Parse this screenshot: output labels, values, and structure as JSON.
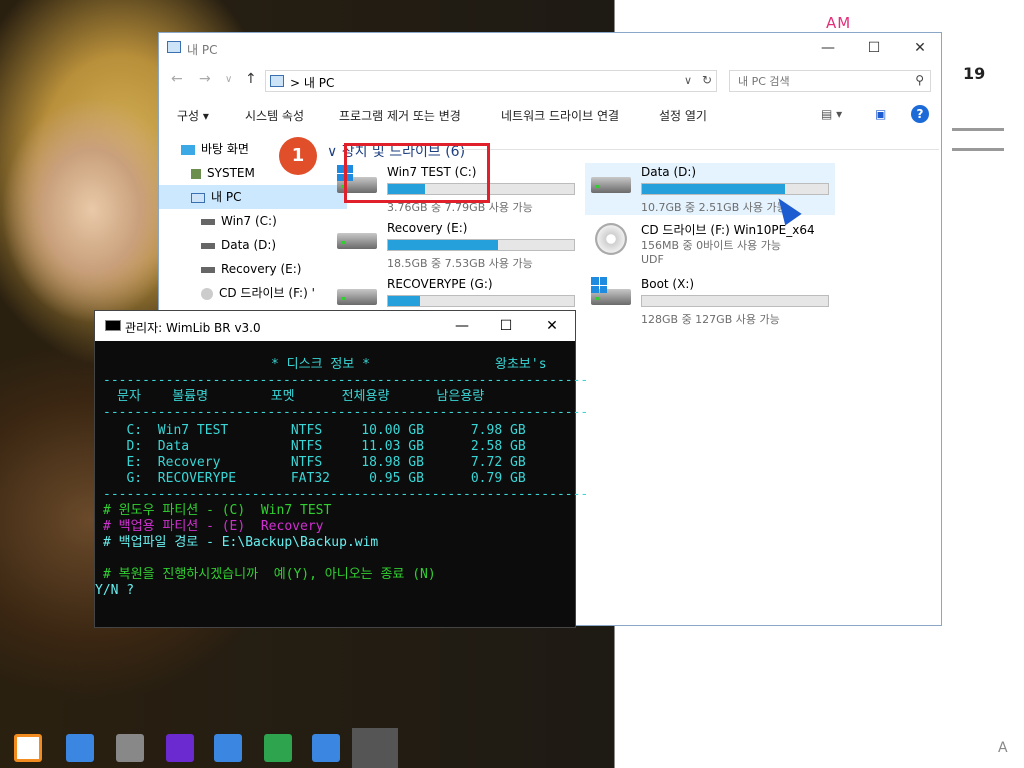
{
  "desktop": {
    "clock_am": "AM",
    "clock_num": "19"
  },
  "explorer": {
    "title": "내 PC",
    "address": "내 PC",
    "address_sep": ">",
    "search_placeholder": "내 PC 검색",
    "commands": [
      "구성 ▾",
      "시스템 속성",
      "프로그램 제거 또는 변경",
      "네트워크 드라이브 연결",
      "설정 열기"
    ],
    "sidebar": [
      {
        "label": "바탕 화면",
        "icon": "desktop-icon"
      },
      {
        "label": "SYSTEM",
        "icon": "user-icon"
      },
      {
        "label": "내 PC",
        "icon": "pc-icon"
      },
      {
        "label": "Win7 (C:)",
        "icon": "drive-icon"
      },
      {
        "label": "Data (D:)",
        "icon": "drive-icon"
      },
      {
        "label": "Recovery (E:)",
        "icon": "drive-icon"
      },
      {
        "label": "CD 드라이브 (F:) '",
        "icon": "cd-icon"
      }
    ],
    "group_header": "장치 및 드라이브 (6)",
    "drives": [
      {
        "name": "Win7 TEST (C:)",
        "info": "3.76GB 중 7.79GB 사용 가능",
        "used": 0.2
      },
      {
        "name": "Data (D:)",
        "info": "10.7GB 중 2.51GB 사용 가능",
        "used": 0.77
      },
      {
        "name": "Recovery (E:)",
        "info": "18.5GB 중 7.53GB 사용 가능",
        "used": 0.59
      },
      {
        "name": "CD 드라이브 (F:) Win10PE_x64",
        "info": "156MB 중 0바이트 사용 가능",
        "info2": "UDF"
      },
      {
        "name": "RECOVERYPE (G:)",
        "info": "",
        "used": 0.17
      },
      {
        "name": "Boot (X:)",
        "info": "128GB 중 127GB 사용 가능",
        "used": 0.0
      }
    ]
  },
  "callout": {
    "number": "1"
  },
  "console": {
    "title": "관리자:  WimLib BR v3.0",
    "header_title": "* 디스크 정보 *",
    "header_author": "왕초보's",
    "rule": "--------------------------------------------------------------",
    "columns": "문자    볼륨명        포멧      전체용량      남은용량",
    "rows": [
      "   C:  Win7 TEST        NTFS     10.00 GB      7.98 GB",
      "   D:  Data             NTFS     11.03 GB      2.58 GB",
      "   E:  Recovery         NTFS     18.98 GB      7.72 GB",
      "   G:  RECOVERYPE       FAT32     0.95 GB      0.79 GB"
    ],
    "line_windows": "# 윈도우 파티션 - (C)  Win7 TEST",
    "line_backup": "# 백업용 파티션 - (E)  Recovery",
    "line_file": "# 백업파일 경로 - E:\\Backup\\Backup.wim",
    "line_prompt": "# 복원을 진행하시겠습니까  예(Y), 아니오는 종료 (N)",
    "line_yn": "Y/N ?"
  },
  "colors": {
    "accent": "#26a0da",
    "callout_red": "#e0202a",
    "console_bg": "#0c0c0c"
  }
}
